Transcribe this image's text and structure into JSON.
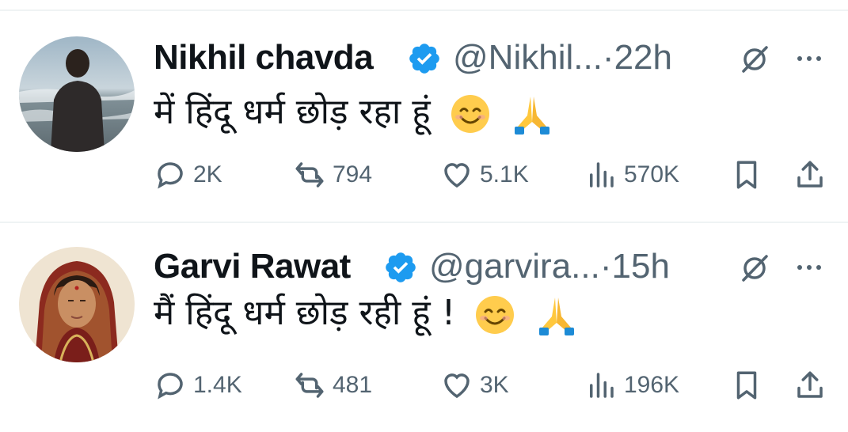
{
  "tweets": [
    {
      "display_name": "Nikhil chavda",
      "handle": "@Nikhil...",
      "time": "·22h",
      "text": "में हिंदू धर्म छोड़ रहा हूं",
      "emojis": [
        "smiling-face",
        "folded-hands"
      ],
      "verified": true,
      "stats": {
        "replies": "2K",
        "reposts": "794",
        "likes": "5.1K",
        "views": "570K"
      }
    },
    {
      "display_name": "Garvi Rawat",
      "handle": "@garvira...",
      "time": "·15h",
      "text": "मैं हिंदू धर्म छोड़ रही हूं !",
      "emojis": [
        "smiling-face",
        "folded-hands"
      ],
      "verified": true,
      "stats": {
        "replies": "1.4K",
        "reposts": "481",
        "likes": "3K",
        "views": "196K"
      }
    }
  ],
  "colors": {
    "verified": "#1d9bf0",
    "secondary_text": "#536471",
    "divider": "#eff3f4"
  },
  "icons": [
    "verified-badge-icon",
    "grok-icon",
    "more-icon",
    "reply-icon",
    "repost-icon",
    "like-icon",
    "views-icon",
    "bookmark-icon",
    "share-icon"
  ]
}
